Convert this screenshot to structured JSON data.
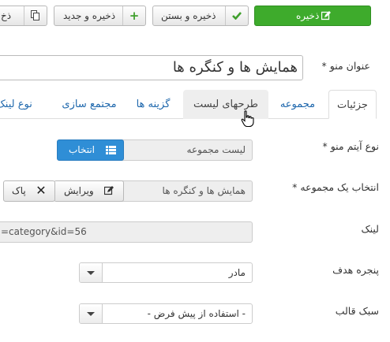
{
  "toolbar": {
    "save_label": "ذخیره",
    "save_close_label": "ذخیره و بستن",
    "save_new_label": "ذخیره و جدید",
    "save_copy_label": "ذخ",
    "save_color": "#3eab2c"
  },
  "title_field": {
    "label": "عنوان منو",
    "required_mark": "*",
    "value": "همایش ها و کنگره ها"
  },
  "tabs": [
    {
      "label": "جزئیات",
      "active": true
    },
    {
      "label": "مجموعه"
    },
    {
      "label": "طرحهای لیست",
      "hover": true
    },
    {
      "label": "گزینه ها"
    },
    {
      "label": "مجتمع سازی"
    },
    {
      "label": "نوع لینک"
    }
  ],
  "menu_item_type": {
    "label": "نوع آیتم منو",
    "required_mark": "*",
    "value": "لیست مجموعه",
    "select_button": "انتخاب"
  },
  "category": {
    "label": "انتخاب یک مجموعه",
    "required_mark": "*",
    "value": "همایش ها و کنگره ها",
    "edit_button": "ویرایش",
    "clear_button": "پاک"
  },
  "link": {
    "label": "لینک",
    "value": "=category&id=56"
  },
  "target_window": {
    "label": "پنجره هدف",
    "value": "مادر"
  },
  "template_style": {
    "label": "سبک قالب",
    "value": "- استفاده از پیش فرض -"
  },
  "colors": {
    "primary_blue": "#2f8ed6",
    "tab_link": "#1f68ad"
  }
}
